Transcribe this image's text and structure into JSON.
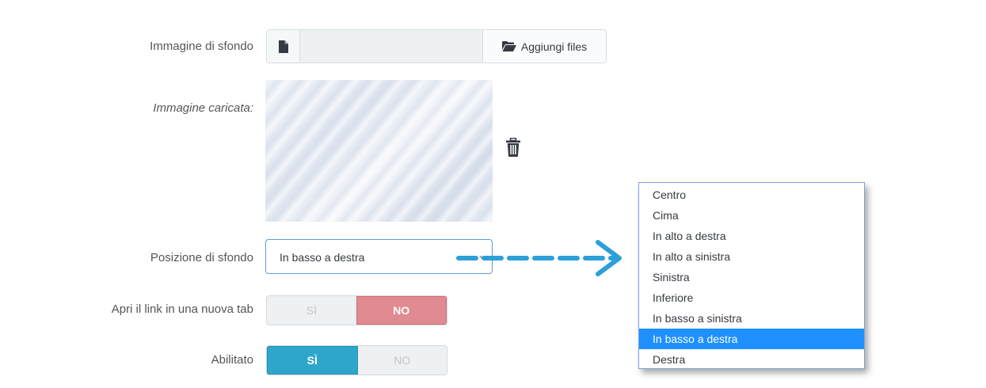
{
  "background_image": {
    "label": "Immagine di sfondo",
    "add_files_label": "Aggiungi files"
  },
  "uploaded_image": {
    "label": "Immagine caricata:"
  },
  "position": {
    "label": "Posizione di sfondo",
    "selected_value": "In basso a destra",
    "options": [
      "Centro",
      "Cima",
      "In alto a destra",
      "In alto a sinistra",
      "Sinistra",
      "Inferiore",
      "In basso a sinistra",
      "In basso a destra",
      "Destra"
    ],
    "highlighted_option": "In basso a destra"
  },
  "new_tab": {
    "label": "Apri il link in una nuova tab",
    "yes_label": "SÌ",
    "no_label": "NO",
    "value": "NO"
  },
  "enabled": {
    "label": "Abilitato",
    "yes_label": "SÌ",
    "no_label": "NO",
    "value": "SÌ"
  },
  "colors": {
    "yes_active": "#2ea6cb",
    "no_active": "#e08a92",
    "highlight": "#1e90ff",
    "arrow": "#2d9fd9"
  },
  "icons": {
    "file": "file-icon",
    "folder": "folder-open-icon",
    "trash": "trash-icon",
    "caret": "chevron-down-icon",
    "arrow": "dashed-arrow-right"
  }
}
